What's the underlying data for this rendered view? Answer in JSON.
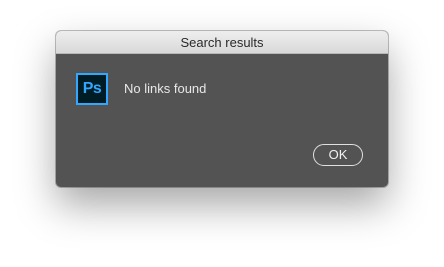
{
  "dialog": {
    "title": "Search results",
    "app_icon": {
      "name": "photoshop-icon",
      "text": "Ps",
      "colors": {
        "background": "#001d26",
        "accent": "#31a8ff"
      }
    },
    "message": "No links found",
    "ok_label": "OK",
    "colors": {
      "body": "#535353",
      "titlebar": "#dedede",
      "message_text": "#e8e8e8"
    }
  }
}
